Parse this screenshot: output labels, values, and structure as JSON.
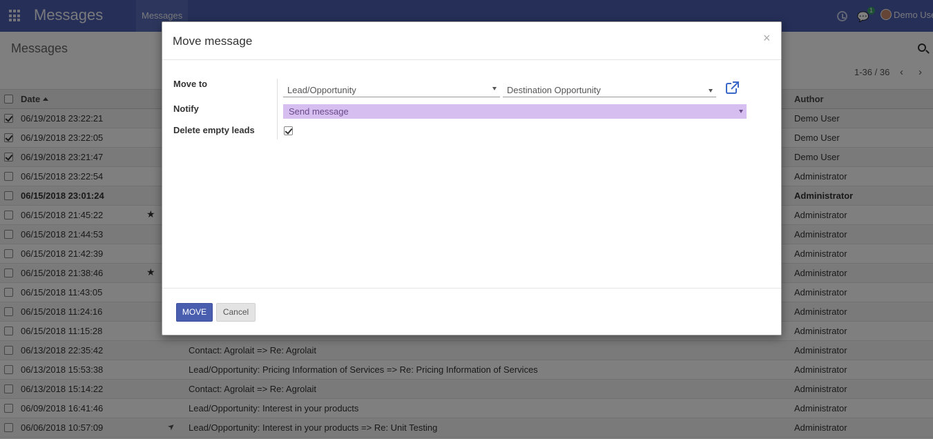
{
  "navbar": {
    "app_title": "Messages",
    "menu_item": "Messages",
    "chat_badge": "1",
    "user_name": "Demo User"
  },
  "control_panel": {
    "breadcrumb": "Messages",
    "pager": "1-36 / 36"
  },
  "list": {
    "columns": {
      "date": "Date",
      "author": "Author"
    },
    "rows": [
      {
        "date": "06/19/2018 23:22:21",
        "subject": "",
        "author": "Demo User",
        "checked": true
      },
      {
        "date": "06/19/2018 23:22:05",
        "subject": "",
        "author": "Demo User",
        "checked": true
      },
      {
        "date": "06/19/2018 23:21:47",
        "subject": "",
        "author": "Demo User",
        "checked": true
      },
      {
        "date": "06/15/2018 23:22:54",
        "subject": "",
        "author": "Administrator"
      },
      {
        "date": "06/15/2018 23:01:24",
        "subject": "",
        "author": "Administrator",
        "bold": true
      },
      {
        "date": "06/15/2018 21:45:22",
        "subject": "",
        "author": "Administrator",
        "starred": true
      },
      {
        "date": "06/15/2018 21:44:53",
        "subject": "",
        "author": "Administrator"
      },
      {
        "date": "06/15/2018 21:42:39",
        "subject": "",
        "author": "Administrator"
      },
      {
        "date": "06/15/2018 21:38:46",
        "subject": "",
        "author": "Administrator",
        "starred": true
      },
      {
        "date": "06/15/2018 11:43:05",
        "subject": "",
        "author": "Administrator"
      },
      {
        "date": "06/15/2018 11:24:16",
        "subject": "",
        "author": "Administrator"
      },
      {
        "date": "06/15/2018 11:15:28",
        "subject": "",
        "author": "Administrator"
      },
      {
        "date": "06/13/2018 22:35:42",
        "subject": "Contact: Agrolait => Re: Agrolait",
        "author": "Administrator"
      },
      {
        "date": "06/13/2018 15:53:38",
        "subject": "Lead/Opportunity: Pricing Information of Services => Re: Pricing Information of Services",
        "author": "Administrator"
      },
      {
        "date": "06/13/2018 15:14:22",
        "subject": "Contact: Agrolait => Re: Agrolait",
        "author": "Administrator"
      },
      {
        "date": "06/09/2018 16:41:46",
        "subject": "Lead/Opportunity: Interest in your products",
        "author": "Administrator"
      },
      {
        "date": "06/06/2018 10:57:09",
        "subject": "Lead/Opportunity: Interest in your products => Re: Unit Testing",
        "author": "Administrator",
        "attachment": true
      }
    ]
  },
  "modal": {
    "title": "Move message",
    "close": "×",
    "move_to_label": "Move to",
    "model_value": "Lead/Opportunity",
    "destination_placeholder": "Destination Opportunity",
    "notify_label": "Notify",
    "notify_value": "Send message",
    "delete_empty_label": "Delete empty leads",
    "delete_empty_checked": true,
    "move_button": "MOVE",
    "cancel_button": "Cancel"
  }
}
